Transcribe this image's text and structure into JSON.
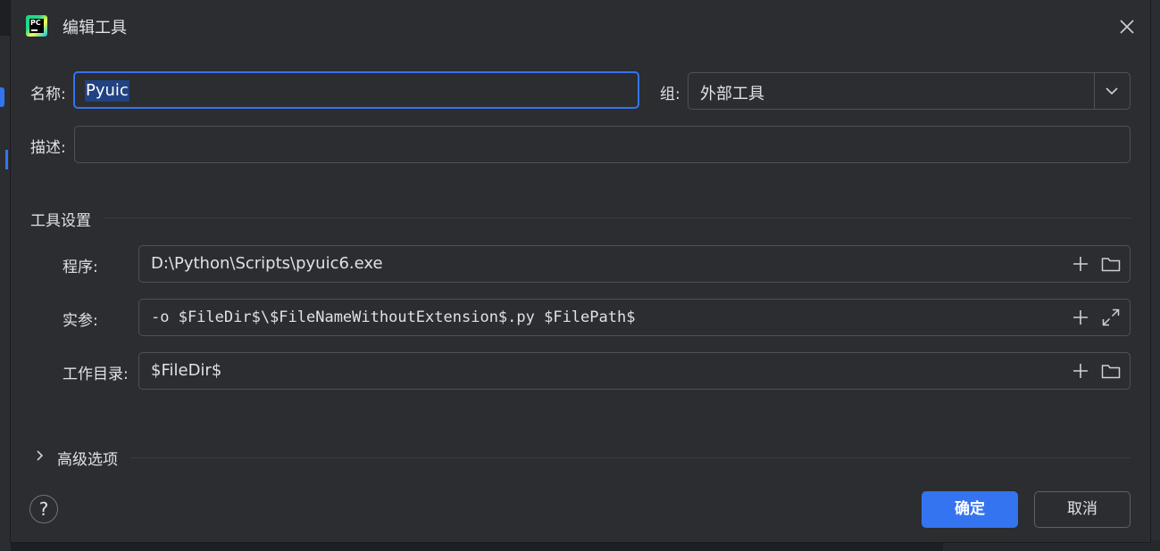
{
  "window": {
    "title": "编辑工具",
    "logo_text": "PC"
  },
  "form": {
    "name_label": "名称:",
    "name_value": "Pyuic",
    "group_label": "组:",
    "group_value": "外部工具",
    "description_label": "描述:",
    "description_value": ""
  },
  "tool_settings": {
    "section_title": "工具设置",
    "program_label": "程序:",
    "program_value": "D:\\Python\\Scripts\\pyuic6.exe",
    "arguments_label": "实参:",
    "arguments_value": "-o $FileDir$\\$FileNameWithoutExtension$.py $FilePath$",
    "workdir_label": "工作目录:",
    "workdir_value": "$FileDir$"
  },
  "advanced": {
    "label": "高级选项"
  },
  "footer": {
    "help_label": "?",
    "ok_label": "确定",
    "cancel_label": "取消"
  },
  "icons": {
    "logo": "pycharm-logo-icon",
    "close": "close-icon",
    "dropdown": "chevron-down-icon",
    "add": "plus-icon",
    "browse": "folder-icon",
    "expand": "expand-icon",
    "collapse_toggle": "chevron-right-icon"
  },
  "colors": {
    "accent": "#3574f0",
    "background": "#2b2d30",
    "border": "#4e5157",
    "selection": "#214283"
  }
}
